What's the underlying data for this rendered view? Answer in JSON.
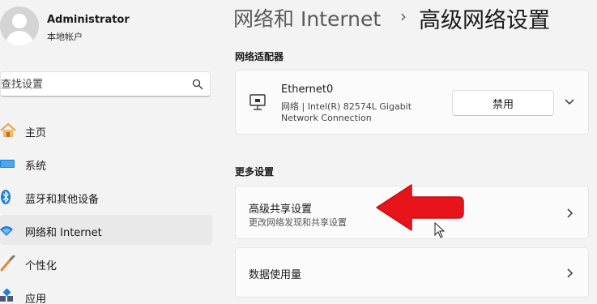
{
  "user": {
    "name": "Administrator",
    "account_type": "本地帐户"
  },
  "search": {
    "placeholder": "查找设置",
    "icon": "search-icon"
  },
  "nav": {
    "items": [
      {
        "label": "主页",
        "icon": "home-icon",
        "selected": false
      },
      {
        "label": "系统",
        "icon": "system-display-icon",
        "selected": false
      },
      {
        "label": "蓝牙和其他设备",
        "icon": "bluetooth-icon",
        "selected": false
      },
      {
        "label": "网络和 Internet",
        "icon": "wifi-icon",
        "selected": true
      },
      {
        "label": "个性化",
        "icon": "brush-icon",
        "selected": false
      },
      {
        "label": "应用",
        "icon": "apps-icon",
        "selected": false
      }
    ]
  },
  "breadcrumb": {
    "parent": "网络和 Internet",
    "separator": "›",
    "current": "高级网络设置"
  },
  "adapters_section": {
    "title": "网络适配器",
    "adapter": {
      "name": "Ethernet0",
      "description_line1": "网络 | Intel(R) 82574L Gigabit",
      "description_line2": "Network Connection",
      "disable_label": "禁用",
      "icon": "ethernet-monitor-icon"
    }
  },
  "more_section": {
    "title": "更多设置",
    "items": [
      {
        "title": "高级共享设置",
        "subtitle": "更改网络发现和共享设置"
      },
      {
        "title": "数据使用量",
        "subtitle": ""
      }
    ]
  },
  "colors": {
    "accent": "#0067c0",
    "highlight_arrow": "#e8141c",
    "background": "#f3f3f3",
    "card": "#fbfbfb"
  }
}
